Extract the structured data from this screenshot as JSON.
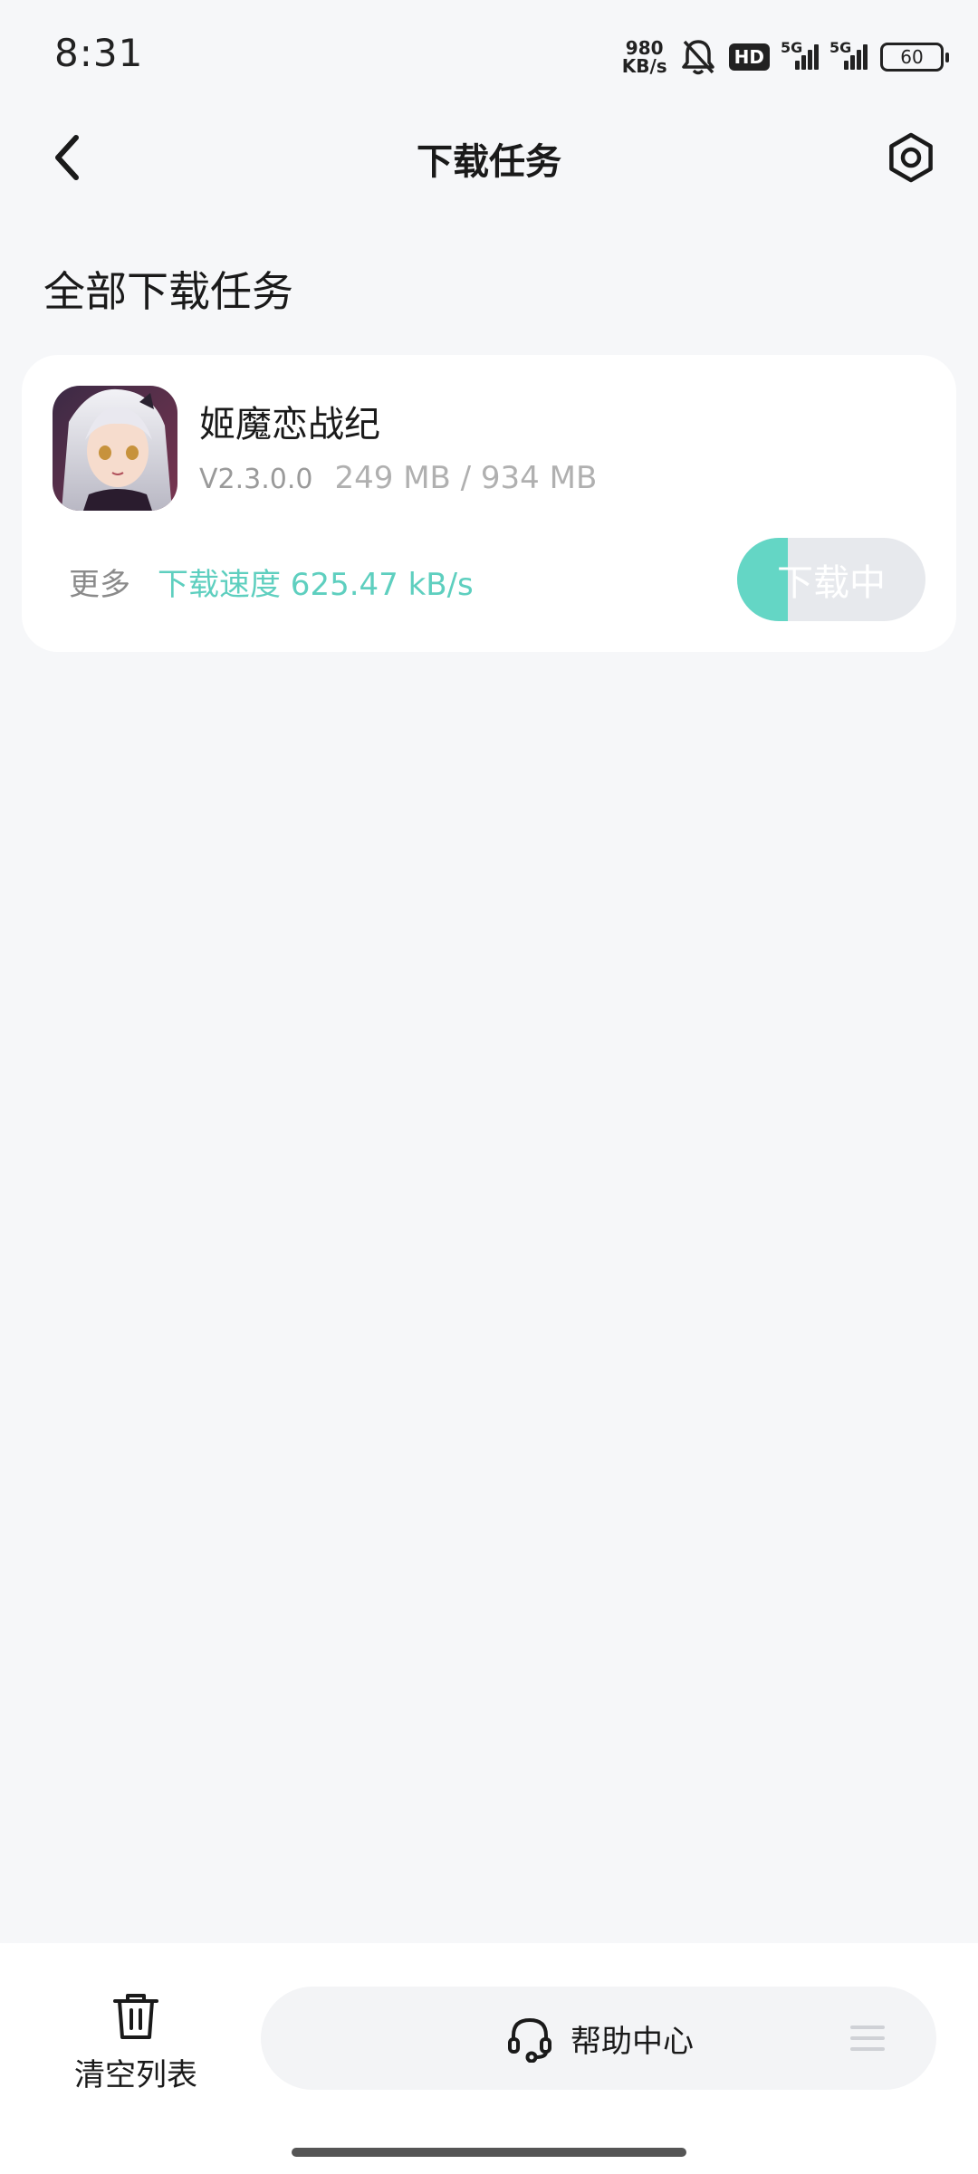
{
  "status_bar": {
    "time": "8:31",
    "net_speed_value": "980",
    "net_speed_unit": "KB/s",
    "hd_label": "HD",
    "signal1_label": "5G",
    "signal2_label": "5G",
    "battery_level": "60"
  },
  "header": {
    "title": "下载任务"
  },
  "section": {
    "title": "全部下载任务"
  },
  "download_item": {
    "name": "姬魔恋战纪",
    "version": "V2.3.0.0",
    "size": "249 MB / 934 MB",
    "more_label": "更多",
    "speed_label": "下载速度 625.47 kB/s",
    "button_label": "下载中",
    "progress_fraction": 0.27
  },
  "bottom_bar": {
    "clear_label": "清空列表",
    "help_label": "帮助中心"
  },
  "colors": {
    "accent": "#5ecfbf",
    "progress_fill": "#64d6c5",
    "background": "#f6f7f9"
  }
}
